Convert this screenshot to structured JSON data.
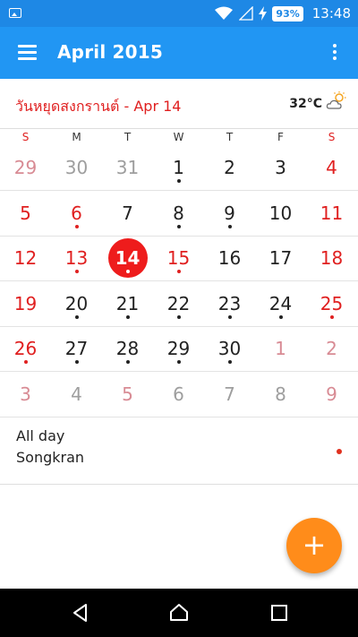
{
  "status_bar": {
    "battery": "93%",
    "time": "13:48"
  },
  "app_bar": {
    "title": "April 2015"
  },
  "banner": {
    "holiday": "วันหยุดสงกรานต์ - Apr 14",
    "temperature": "32°C",
    "weather_icon": "partly-cloudy-icon"
  },
  "weekdays": [
    "S",
    "M",
    "T",
    "W",
    "T",
    "F",
    "S"
  ],
  "weeks": [
    [
      {
        "d": "29",
        "muted": true,
        "red": true,
        "dot": false
      },
      {
        "d": "30",
        "muted": true,
        "red": false,
        "dot": false
      },
      {
        "d": "31",
        "muted": true,
        "red": false,
        "dot": false
      },
      {
        "d": "1",
        "muted": false,
        "red": false,
        "dot": true
      },
      {
        "d": "2",
        "muted": false,
        "red": false,
        "dot": false
      },
      {
        "d": "3",
        "muted": false,
        "red": false,
        "dot": false
      },
      {
        "d": "4",
        "muted": false,
        "red": true,
        "dot": false
      }
    ],
    [
      {
        "d": "5",
        "muted": false,
        "red": true,
        "dot": false
      },
      {
        "d": "6",
        "muted": false,
        "red": true,
        "dot": true
      },
      {
        "d": "7",
        "muted": false,
        "red": false,
        "dot": false
      },
      {
        "d": "8",
        "muted": false,
        "red": false,
        "dot": true
      },
      {
        "d": "9",
        "muted": false,
        "red": false,
        "dot": true
      },
      {
        "d": "10",
        "muted": false,
        "red": false,
        "dot": false
      },
      {
        "d": "11",
        "muted": false,
        "red": true,
        "dot": false
      }
    ],
    [
      {
        "d": "12",
        "muted": false,
        "red": true,
        "dot": false
      },
      {
        "d": "13",
        "muted": false,
        "red": true,
        "dot": true
      },
      {
        "d": "14",
        "muted": false,
        "red": true,
        "dot": true,
        "today": true
      },
      {
        "d": "15",
        "muted": false,
        "red": true,
        "dot": true
      },
      {
        "d": "16",
        "muted": false,
        "red": false,
        "dot": false
      },
      {
        "d": "17",
        "muted": false,
        "red": false,
        "dot": false
      },
      {
        "d": "18",
        "muted": false,
        "red": true,
        "dot": false
      }
    ],
    [
      {
        "d": "19",
        "muted": false,
        "red": true,
        "dot": false
      },
      {
        "d": "20",
        "muted": false,
        "red": false,
        "dot": true
      },
      {
        "d": "21",
        "muted": false,
        "red": false,
        "dot": true
      },
      {
        "d": "22",
        "muted": false,
        "red": false,
        "dot": true
      },
      {
        "d": "23",
        "muted": false,
        "red": false,
        "dot": true
      },
      {
        "d": "24",
        "muted": false,
        "red": false,
        "dot": true
      },
      {
        "d": "25",
        "muted": false,
        "red": true,
        "dot": true
      }
    ],
    [
      {
        "d": "26",
        "muted": false,
        "red": true,
        "dot": true
      },
      {
        "d": "27",
        "muted": false,
        "red": false,
        "dot": true
      },
      {
        "d": "28",
        "muted": false,
        "red": false,
        "dot": true
      },
      {
        "d": "29",
        "muted": false,
        "red": false,
        "dot": true
      },
      {
        "d": "30",
        "muted": false,
        "red": false,
        "dot": true
      },
      {
        "d": "1",
        "muted": true,
        "red": true,
        "dot": false
      },
      {
        "d": "2",
        "muted": true,
        "red": true,
        "dot": false
      }
    ],
    [
      {
        "d": "3",
        "muted": true,
        "red": true,
        "dot": false
      },
      {
        "d": "4",
        "muted": true,
        "red": false,
        "dot": false
      },
      {
        "d": "5",
        "muted": true,
        "red": true,
        "dot": false
      },
      {
        "d": "6",
        "muted": true,
        "red": false,
        "dot": false
      },
      {
        "d": "7",
        "muted": true,
        "red": false,
        "dot": false
      },
      {
        "d": "8",
        "muted": true,
        "red": false,
        "dot": false
      },
      {
        "d": "9",
        "muted": true,
        "red": true,
        "dot": false
      }
    ]
  ],
  "events": {
    "all_day_label": "All day",
    "items": [
      {
        "name": "Songkran",
        "color": "#e0301e"
      }
    ]
  },
  "fab": {
    "label": "+"
  },
  "colors": {
    "app_bar": "#2196f3",
    "status_bar": "#1e88e5",
    "holiday_red": "#e02020",
    "fab": "#ff8c1a"
  }
}
